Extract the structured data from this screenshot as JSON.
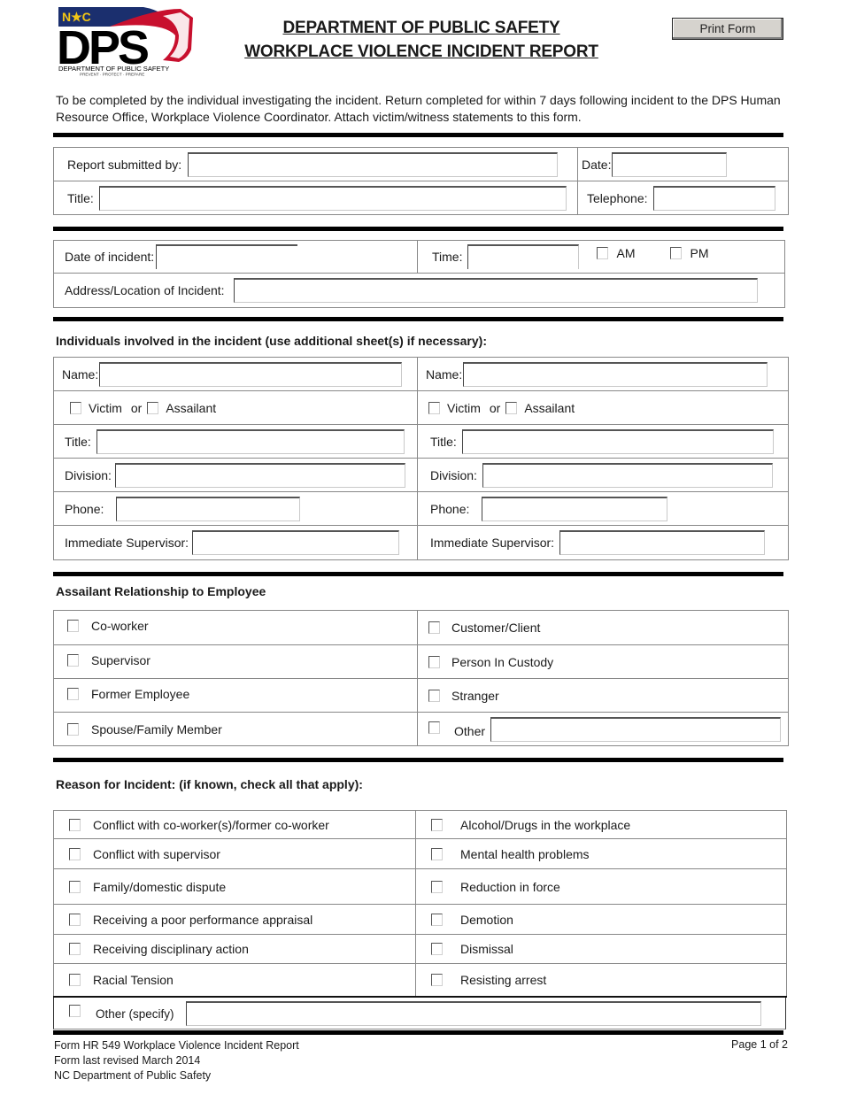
{
  "logo": {
    "state_badge": "N★C",
    "brand": "DPS",
    "org_name": "DEPARTMENT OF PUBLIC SAFETY",
    "tagline": "PREVENT · PROTECT · PREPARE",
    "colors": {
      "navy": "#1b2f6e",
      "gold": "#f2c515",
      "red": "#c8102e",
      "black": "#000000"
    }
  },
  "header": {
    "title_line1": "DEPARTMENT OF PUBLIC SAFETY",
    "title_line2": "WORKPLACE VIOLENCE INCIDENT REPORT",
    "print_button": "Print Form"
  },
  "instructions": "To be completed by the individual investigating the incident. Return completed for within 7 days following incident to the DPS Human Resource Office, Workplace Violence Coordinator. Attach victim/witness statements to this form.",
  "submitter": {
    "submitted_by_label": "Report submitted by:",
    "submitted_by_value": "",
    "date_label": "Date:",
    "date_value": "",
    "title_label": "Title:",
    "title_value": "",
    "telephone_label": "Telephone:",
    "telephone_value": ""
  },
  "incident": {
    "date_label": "Date of incident:",
    "date_value": "",
    "time_label": "Time:",
    "time_value": "",
    "am_label": "AM",
    "pm_label": "PM",
    "am_checked": false,
    "pm_checked": false,
    "location_label": "Address/Location of Incident:",
    "location_value": ""
  },
  "individuals": {
    "heading": "Individuals involved in the incident (use additional sheet(s) if necessary):",
    "persons": [
      {
        "name_label": "Name:",
        "victim_label": "Victim",
        "or_label": "or",
        "assailant_label": "Assailant",
        "title_label": "Title:",
        "division_label": "Division:",
        "phone_label": "Phone:",
        "supervisor_label": "Immediate Supervisor:",
        "name": "",
        "title": "",
        "division": "",
        "phone": "",
        "supervisor": "",
        "victim": false,
        "assailant": false
      },
      {
        "name_label": "Name:",
        "victim_label": "Victim",
        "or_label": "or",
        "assailant_label": "Assailant",
        "title_label": "Title:",
        "division_label": "Division:",
        "phone_label": "Phone:",
        "supervisor_label": "Immediate Supervisor:",
        "name": "",
        "title": "",
        "division": "",
        "phone": "",
        "supervisor": "",
        "victim": false,
        "assailant": false
      }
    ]
  },
  "relationship": {
    "heading": "Assailant Relationship to Employee",
    "left": [
      "Co-worker",
      "Supervisor",
      "Former Employee",
      "Spouse/Family Member"
    ],
    "right": [
      "Customer/Client",
      "Person In Custody",
      "Stranger",
      "Other"
    ],
    "other_value": ""
  },
  "reason": {
    "heading": "Reason for Incident: (if known, check all that apply):",
    "left": [
      "Conflict with co-worker(s)/former co-worker",
      "Conflict with supervisor",
      "Family/domestic dispute",
      "Receiving a poor performance appraisal",
      "Receiving disciplinary action",
      "Racial Tension"
    ],
    "right": [
      "Alcohol/Drugs in the workplace",
      "Mental health problems",
      "Reduction in force",
      "Demotion",
      "Dismissal",
      "Resisting arrest"
    ],
    "other_label": "Other (specify)",
    "other_value": ""
  },
  "footer": {
    "form_name": "Form HR 549 Workplace Violence Incident Report",
    "revised": "Form last revised March 2014",
    "agency": "NC Department of Public Safety",
    "page": "Page 1 of 2"
  }
}
